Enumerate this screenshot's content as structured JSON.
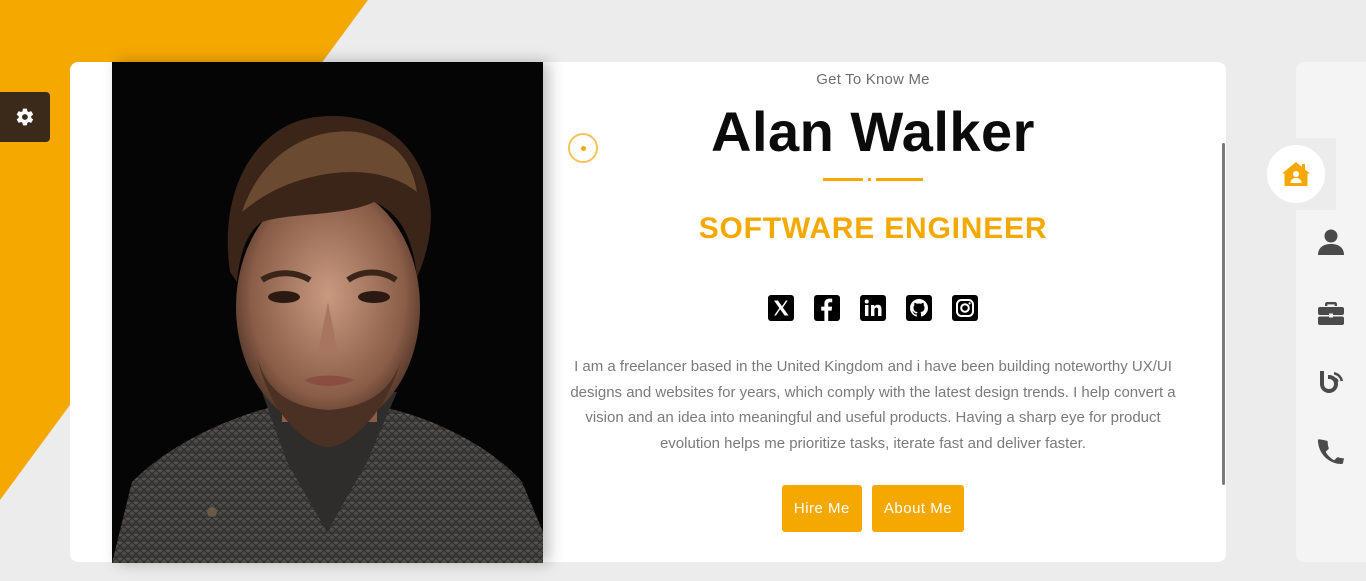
{
  "hero": {
    "eyebrow": "Get To Know Me",
    "name": "Alan Walker",
    "role": "SOFTWARE ENGINEER",
    "bio": "I am a freelancer based in the United Kingdom and i have been building noteworthy UX/UI designs and websites for years, which comply with the latest design trends. I help convert a vision and an idea into meaningful and useful products. Having a sharp eye for product evolution helps me prioritize tasks, iterate fast and deliver faster."
  },
  "buttons": {
    "hire": "Hire Me",
    "about": "About Me"
  },
  "socials": [
    {
      "icon": "x-twitter-icon"
    },
    {
      "icon": "facebook-icon"
    },
    {
      "icon": "linkedin-icon"
    },
    {
      "icon": "github-icon"
    },
    {
      "icon": "instagram-icon"
    }
  ],
  "nav": [
    {
      "icon": "home-icon",
      "active": true
    },
    {
      "icon": "user-icon"
    },
    {
      "icon": "briefcase-icon"
    },
    {
      "icon": "blog-icon"
    },
    {
      "icon": "phone-icon"
    }
  ],
  "colors": {
    "accent": "#f5a800",
    "background": "#ececec",
    "settings": "#3b2a1a",
    "text": "#0b0b0b",
    "muted": "#7a7a7a"
  }
}
